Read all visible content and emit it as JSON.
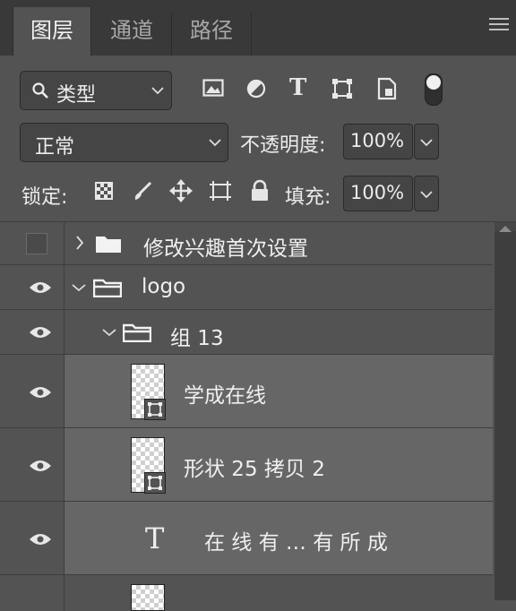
{
  "tabs": [
    "图层",
    "通道",
    "路径"
  ],
  "filter": {
    "label": "类型"
  },
  "blend": {
    "mode": "正常",
    "opacity_label": "不透明度:",
    "opacity_value": "100%"
  },
  "lock": {
    "label": "锁定:",
    "fill_label": "填充:",
    "fill_value": "100%"
  },
  "layers": [
    {
      "name": "修改兴趣首次设置",
      "kind": "group",
      "expanded": false,
      "visible": false
    },
    {
      "name": "logo",
      "kind": "group",
      "expanded": true,
      "visible": true
    },
    {
      "name": "组 13",
      "kind": "group",
      "expanded": true,
      "visible": true
    },
    {
      "name": "学成在线",
      "kind": "smart-object",
      "visible": true,
      "selected": true
    },
    {
      "name": "形状 25 拷贝 2",
      "kind": "smart-object",
      "visible": true,
      "selected": true
    },
    {
      "name": "在 线 有 … 有 所 成",
      "kind": "text",
      "visible": true,
      "selected": true
    }
  ],
  "icons": {
    "filter_search": "search-icon",
    "filter_kinds": [
      "image-filter-icon",
      "adjustment-filter-icon",
      "type-filter-icon",
      "shape-filter-icon",
      "smart-object-filter-icon",
      "filter-toggle-icon"
    ],
    "locks": [
      "lock-transparent-pixels-icon",
      "lock-image-pixels-icon",
      "lock-position-icon",
      "lock-artboard-icon",
      "lock-all-icon"
    ],
    "panel_menu": "panel-menu-icon",
    "visibility": "eye-icon",
    "folder": "folder-icon"
  },
  "colors": {
    "panel_bg": "#535353",
    "tab_bar_bg": "#393939",
    "selected_row_bg": "#666666",
    "field_bg": "#454545"
  }
}
